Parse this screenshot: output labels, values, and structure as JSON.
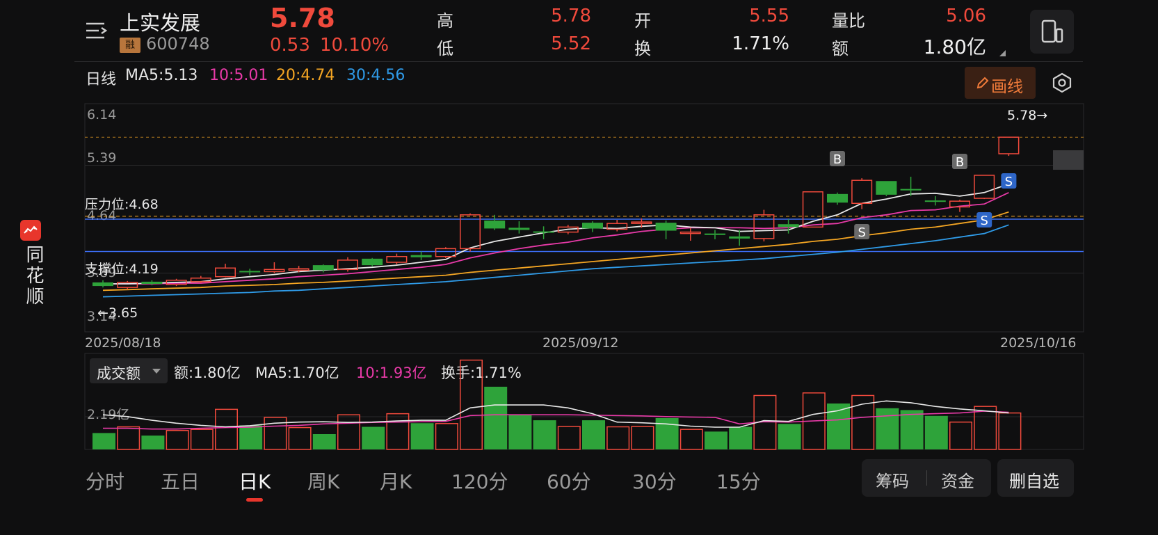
{
  "stock": {
    "name": "上实发展",
    "tag": "融",
    "code": "600748",
    "price": "5.78",
    "change": "0.53",
    "change_pct": "10.10%"
  },
  "quote": {
    "high_label": "高",
    "high": "5.78",
    "low_label": "低",
    "low": "5.52",
    "open_label": "开",
    "open": "5.55",
    "turnover_label": "换",
    "turnover": "1.71%",
    "vol_ratio_label": "量比",
    "vol_ratio": "5.06",
    "amount_label": "额",
    "amount": "1.80亿"
  },
  "sidebar": {
    "app_name": "同花顺"
  },
  "ma_bar": {
    "period": "日线",
    "ma5": "MA5:5.13",
    "ma10": "10:5.01",
    "ma20": "20:4.74",
    "ma30": "30:4.56",
    "draw_label": "画线"
  },
  "price_chart": {
    "y_labels": [
      "6.14",
      "5.39",
      "4.64",
      "3.89",
      "3.14"
    ],
    "resistance": "压力位:4.68",
    "support": "支撑位:4.19",
    "low_marker": "←3.65",
    "high_marker": "5.78→",
    "dates": [
      "2025/08/18",
      "2025/09/12",
      "2025/10/16"
    ],
    "signals": {
      "buy": "B",
      "sell": "S"
    }
  },
  "volume_bar": {
    "selector": "成交额",
    "amount": "额:1.80亿",
    "ma5": "MA5:1.70亿",
    "ma10": "10:1.93亿",
    "turnover": "换手:1.71%",
    "y_label": "2.19亿"
  },
  "tabs": [
    "分时",
    "五日",
    "日K",
    "周K",
    "月K",
    "120分",
    "60分",
    "30分",
    "15分"
  ],
  "buttons": {
    "chips": "筹码",
    "funds": "资金",
    "remove": "删自选"
  },
  "colors": {
    "up": "#f04a3c",
    "down": "#2ea33a",
    "ma5": "#e8e8e8",
    "ma10": "#e83aa8",
    "ma20": "#f5a623",
    "ma30": "#2f9be8",
    "level_line": "#3b6cf0"
  },
  "chart_data": {
    "type": "candlestick",
    "candles": [
      {
        "o": 3.76,
        "c": 3.71,
        "h": 3.79,
        "l": 3.69
      },
      {
        "o": 3.69,
        "c": 3.76,
        "h": 3.78,
        "l": 3.66
      },
      {
        "o": 3.77,
        "c": 3.74,
        "h": 3.79,
        "l": 3.72
      },
      {
        "o": 3.73,
        "c": 3.79,
        "h": 3.81,
        "l": 3.71
      },
      {
        "o": 3.77,
        "c": 3.82,
        "h": 3.85,
        "l": 3.75
      },
      {
        "o": 3.84,
        "c": 3.96,
        "h": 4.02,
        "l": 3.83
      },
      {
        "o": 3.92,
        "c": 3.9,
        "h": 3.95,
        "l": 3.86
      },
      {
        "o": 3.91,
        "c": 3.94,
        "h": 4.04,
        "l": 3.89
      },
      {
        "o": 3.93,
        "c": 3.95,
        "h": 3.99,
        "l": 3.9
      },
      {
        "o": 4.0,
        "c": 3.93,
        "h": 4.01,
        "l": 3.9
      },
      {
        "o": 3.94,
        "c": 4.07,
        "h": 4.11,
        "l": 3.91
      },
      {
        "o": 4.09,
        "c": 4.0,
        "h": 4.1,
        "l": 3.98
      },
      {
        "o": 4.04,
        "c": 4.12,
        "h": 4.16,
        "l": 4.01
      },
      {
        "o": 4.14,
        "c": 4.11,
        "h": 4.19,
        "l": 4.07
      },
      {
        "o": 4.12,
        "c": 4.23,
        "h": 4.25,
        "l": 4.1
      },
      {
        "o": 4.23,
        "c": 4.7,
        "h": 4.72,
        "l": 4.19
      },
      {
        "o": 4.62,
        "c": 4.51,
        "h": 4.7,
        "l": 4.49
      },
      {
        "o": 4.52,
        "c": 4.49,
        "h": 4.61,
        "l": 4.44
      },
      {
        "o": 4.47,
        "c": 4.46,
        "h": 4.54,
        "l": 4.36
      },
      {
        "o": 4.46,
        "c": 4.53,
        "h": 4.56,
        "l": 4.43
      },
      {
        "o": 4.59,
        "c": 4.51,
        "h": 4.61,
        "l": 4.46
      },
      {
        "o": 4.5,
        "c": 4.58,
        "h": 4.63,
        "l": 4.47
      },
      {
        "o": 4.58,
        "c": 4.6,
        "h": 4.65,
        "l": 4.52
      },
      {
        "o": 4.59,
        "c": 4.48,
        "h": 4.62,
        "l": 4.36
      },
      {
        "o": 4.45,
        "c": 4.46,
        "h": 4.52,
        "l": 4.34
      },
      {
        "o": 4.44,
        "c": 4.42,
        "h": 4.49,
        "l": 4.36
      },
      {
        "o": 4.4,
        "c": 4.37,
        "h": 4.49,
        "l": 4.27
      },
      {
        "o": 4.37,
        "c": 4.7,
        "h": 4.77,
        "l": 4.33
      },
      {
        "o": 4.57,
        "c": 4.53,
        "h": 4.64,
        "l": 4.44
      },
      {
        "o": 4.53,
        "c": 5.02,
        "h": 5.02,
        "l": 4.53
      },
      {
        "o": 4.99,
        "c": 4.87,
        "h": 5.01,
        "l": 4.84
      },
      {
        "o": 4.86,
        "c": 5.18,
        "h": 5.21,
        "l": 4.78
      },
      {
        "o": 5.17,
        "c": 4.98,
        "h": 5.17,
        "l": 4.96
      },
      {
        "o": 5.06,
        "c": 5.04,
        "h": 5.23,
        "l": 4.96
      },
      {
        "o": 4.9,
        "c": 4.88,
        "h": 4.96,
        "l": 4.83
      },
      {
        "o": 4.81,
        "c": 4.89,
        "h": 4.91,
        "l": 4.74
      },
      {
        "o": 4.93,
        "c": 5.25,
        "h": 5.25,
        "l": 4.92
      },
      {
        "o": 5.55,
        "c": 5.78,
        "h": 5.78,
        "l": 5.52
      }
    ],
    "ma5": [
      3.74,
      3.74,
      3.75,
      3.76,
      3.77,
      3.81,
      3.84,
      3.87,
      3.91,
      3.93,
      3.95,
      3.97,
      4.0,
      4.04,
      4.08,
      4.24,
      4.33,
      4.39,
      4.45,
      4.5,
      4.52,
      4.51,
      4.54,
      4.56,
      4.53,
      4.52,
      4.47,
      4.48,
      4.49,
      4.61,
      4.7,
      4.86,
      4.92,
      4.99,
      5.0,
      4.96,
      5.01,
      5.13
    ],
    "ma10": [
      3.74,
      3.74,
      3.74,
      3.75,
      3.75,
      3.77,
      3.79,
      3.81,
      3.84,
      3.86,
      3.88,
      3.91,
      3.94,
      3.97,
      4.01,
      4.1,
      4.17,
      4.23,
      4.28,
      4.32,
      4.38,
      4.42,
      4.47,
      4.5,
      4.52,
      4.52,
      4.52,
      4.51,
      4.52,
      4.56,
      4.58,
      4.66,
      4.7,
      4.76,
      4.77,
      4.82,
      4.85,
      5.01
    ],
    "ma20": [
      3.65,
      3.66,
      3.67,
      3.68,
      3.69,
      3.71,
      3.72,
      3.73,
      3.75,
      3.76,
      3.78,
      3.8,
      3.82,
      3.84,
      3.86,
      3.9,
      3.93,
      3.96,
      3.99,
      4.02,
      4.05,
      4.08,
      4.11,
      4.14,
      4.17,
      4.2,
      4.23,
      4.26,
      4.29,
      4.33,
      4.36,
      4.41,
      4.45,
      4.5,
      4.53,
      4.58,
      4.63,
      4.74
    ],
    "ma30": [
      3.56,
      3.57,
      3.58,
      3.59,
      3.6,
      3.61,
      3.62,
      3.64,
      3.65,
      3.67,
      3.69,
      3.71,
      3.73,
      3.75,
      3.77,
      3.8,
      3.83,
      3.86,
      3.89,
      3.92,
      3.95,
      3.97,
      3.99,
      4.01,
      4.03,
      4.05,
      4.07,
      4.09,
      4.12,
      4.15,
      4.18,
      4.22,
      4.26,
      4.3,
      4.34,
      4.39,
      4.44,
      4.56
    ],
    "price_range": [
      3.14,
      6.14
    ],
    "resistance": 4.68,
    "support": 4.19,
    "volumes": [
      0.45,
      0.62,
      0.38,
      0.52,
      0.55,
      1.1,
      0.66,
      0.88,
      0.6,
      0.42,
      0.95,
      0.62,
      0.98,
      0.72,
      0.71,
      2.45,
      1.72,
      0.95,
      0.8,
      0.63,
      0.8,
      0.62,
      0.63,
      0.86,
      0.55,
      0.49,
      0.62,
      1.48,
      0.7,
      1.55,
      1.26,
      1.48,
      1.13,
      1.08,
      0.92,
      0.75,
      1.18,
      1.0
    ],
    "vol_ma5": [
      0.95,
      0.9,
      0.8,
      0.72,
      0.66,
      0.62,
      0.65,
      0.72,
      0.75,
      0.76,
      0.74,
      0.75,
      0.78,
      0.8,
      0.8,
      1.14,
      1.22,
      1.22,
      1.22,
      1.14,
      0.98,
      0.75,
      0.73,
      0.7,
      0.64,
      0.61,
      0.61,
      0.79,
      0.77,
      0.96,
      1.06,
      1.24,
      1.33,
      1.28,
      1.18,
      1.11,
      1.06,
      1.0
    ],
    "vol_ma10": [
      0.58,
      0.58,
      0.56,
      0.56,
      0.58,
      0.6,
      0.61,
      0.64,
      0.66,
      0.7,
      0.72,
      0.74,
      0.75,
      0.76,
      0.77,
      0.93,
      0.95,
      0.95,
      0.95,
      0.95,
      0.94,
      0.93,
      0.92,
      0.9,
      0.89,
      0.88,
      0.7,
      0.76,
      0.75,
      0.78,
      0.81,
      0.88,
      0.92,
      0.96,
      0.98,
      1.0,
      1.05,
      1.02
    ]
  }
}
